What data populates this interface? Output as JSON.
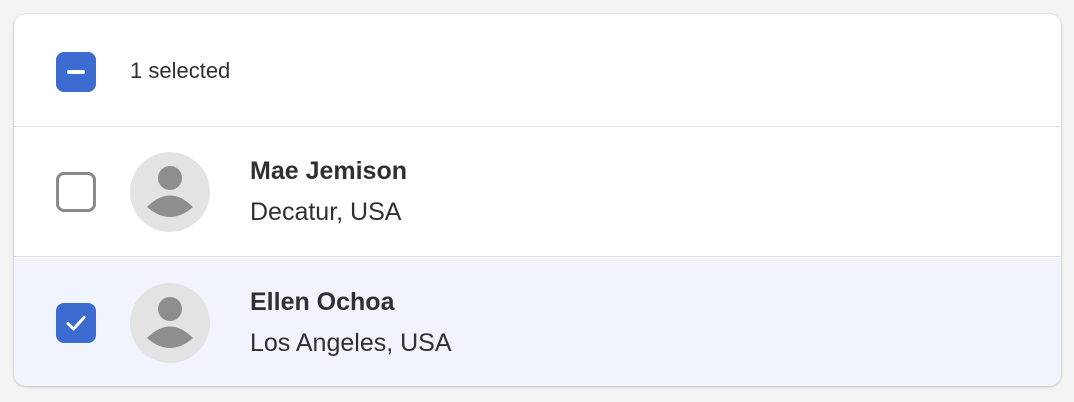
{
  "header": {
    "selection_state": "indeterminate",
    "selected_label": "1 selected"
  },
  "rows": [
    {
      "name": "Mae Jemison",
      "location": "Decatur, USA",
      "checked": false,
      "avatar_icon": "person-placeholder-icon"
    },
    {
      "name": "Ellen Ochoa",
      "location": "Los Angeles, USA",
      "checked": true,
      "avatar_icon": "person-placeholder-icon"
    }
  ],
  "colors": {
    "accent": "#3b6bcf",
    "selected_row_bg": "#f1f4fc",
    "avatar_bg": "#e3e3e3",
    "avatar_figure": "#8e8e8e"
  }
}
